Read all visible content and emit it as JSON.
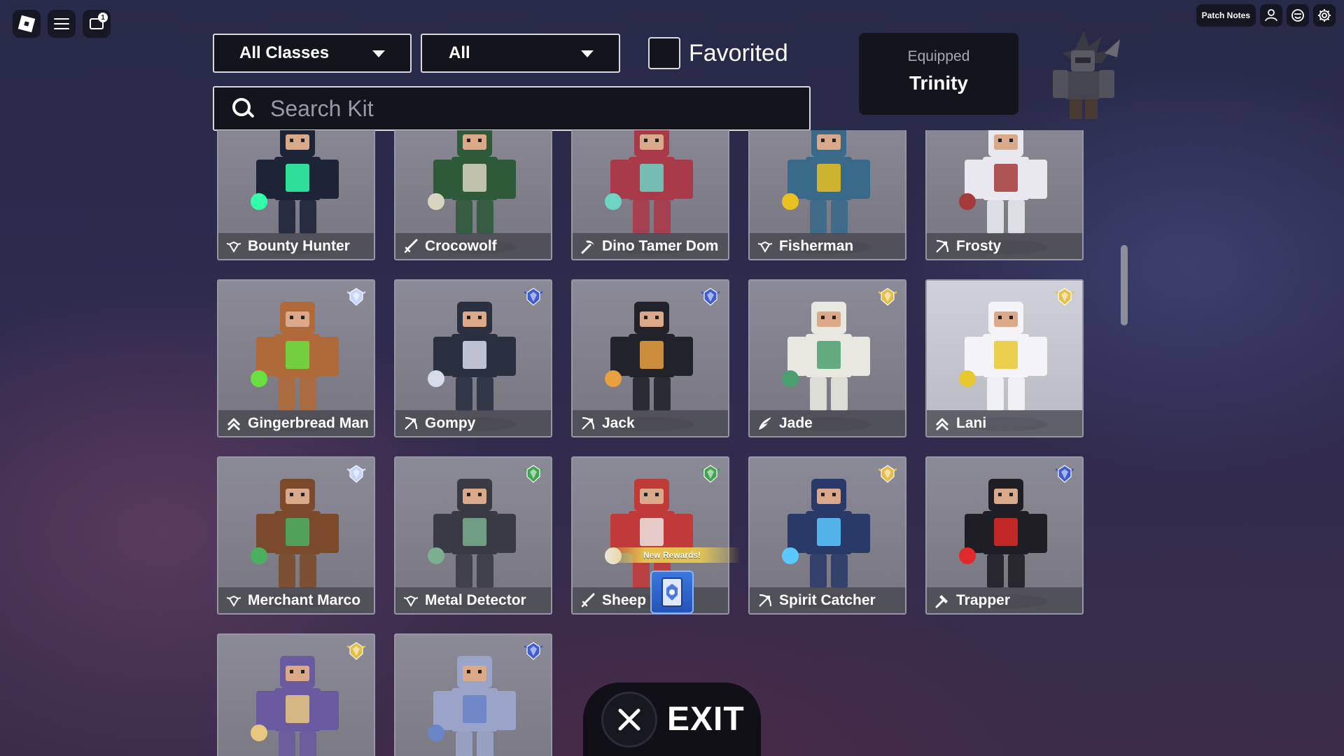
{
  "topbar": {
    "notification_count": "1",
    "patch_notes_label": "Patch Notes"
  },
  "filters": {
    "class_dropdown": "All Classes",
    "rarity_dropdown": "All",
    "favorited_label": "Favorited",
    "favorited_checked": false
  },
  "search": {
    "placeholder": "Search Kit",
    "value": ""
  },
  "equipped": {
    "label": "Equipped",
    "kit_name": "Trinity"
  },
  "kits": [
    {
      "name": "Bounty Hunter",
      "class_icon": "shield-wings-icon",
      "rank_badge": null,
      "colors": [
        "#1e2438",
        "#33ffaa"
      ]
    },
    {
      "name": "Crocowolf",
      "class_icon": "sword-icon",
      "rank_badge": null,
      "colors": [
        "#2f5a3a",
        "#d8d4c0"
      ]
    },
    {
      "name": "Dino Tamer Dom",
      "class_icon": "pickaxe-icon",
      "rank_badge": null,
      "colors": [
        "#a83a4a",
        "#6fd4c4"
      ]
    },
    {
      "name": "Fisherman",
      "class_icon": "shield-wings-icon",
      "rank_badge": null,
      "colors": [
        "#3a6a8a",
        "#e8c020"
      ]
    },
    {
      "name": "Frosty",
      "class_icon": "bow-icon",
      "rank_badge": null,
      "colors": [
        "#e8e8ee",
        "#a43a3a"
      ]
    },
    {
      "name": "Gingerbread Man",
      "class_icon": "chevron-up-icon",
      "rank_badge": "diamond",
      "colors": [
        "#b06a3a",
        "#6ae040"
      ]
    },
    {
      "name": "Gompy",
      "class_icon": "bow-icon",
      "rank_badge": "sapphire",
      "colors": [
        "#2a3040",
        "#d8dcea"
      ]
    },
    {
      "name": "Jack",
      "class_icon": "bow-icon",
      "rank_badge": "sapphire",
      "colors": [
        "#22222a",
        "#e8a040"
      ]
    },
    {
      "name": "Jade",
      "class_icon": "wing-icon",
      "rank_badge": "gold",
      "colors": [
        "#e8e8e0",
        "#4aa070"
      ]
    },
    {
      "name": "Lani",
      "class_icon": "chevron-up-icon",
      "rank_badge": "gold",
      "colors": [
        "#f4f4f8",
        "#e8c830"
      ]
    },
    {
      "name": "Merchant Marco",
      "class_icon": "shield-wings-icon",
      "rank_badge": "diamond",
      "colors": [
        "#7a4a2a",
        "#4ab060"
      ]
    },
    {
      "name": "Metal Detector",
      "class_icon": "shield-wings-icon",
      "rank_badge": "emerald",
      "colors": [
        "#3a3a44",
        "#7ab090"
      ]
    },
    {
      "name": "Sheep",
      "name_suffix": "r",
      "class_icon": "sword-icon",
      "rank_badge": "emerald",
      "colors": [
        "#c03a3a",
        "#ece4e0"
      ]
    },
    {
      "name": "Spirit Catcher",
      "class_icon": "bow-icon",
      "rank_badge": "gold",
      "colors": [
        "#2a3a68",
        "#5ac8ff"
      ]
    },
    {
      "name": "Trapper",
      "class_icon": "hammer-icon",
      "rank_badge": "sapphire",
      "colors": [
        "#1e1e24",
        "#e02a2a"
      ]
    },
    {
      "name": "",
      "class_icon": "sword-icon",
      "rank_badge": "gold",
      "colors": [
        "#6a5aa0",
        "#e8c880"
      ]
    },
    {
      "name": "",
      "class_icon": "bow-icon",
      "rank_badge": "sapphire",
      "colors": [
        "#9aa4c8",
        "#6a84c8"
      ]
    }
  ],
  "rewards": {
    "banner_text": "New Rewards!"
  },
  "exit_label": "EXIT",
  "palette": {
    "panel_bg": "#14141c",
    "card_border": "#9696a4",
    "rank_diamond": "#c8d8ff",
    "rank_sapphire": "#3a5ad8",
    "rank_gold": "#e8c040",
    "rank_emerald": "#3aa84a"
  }
}
